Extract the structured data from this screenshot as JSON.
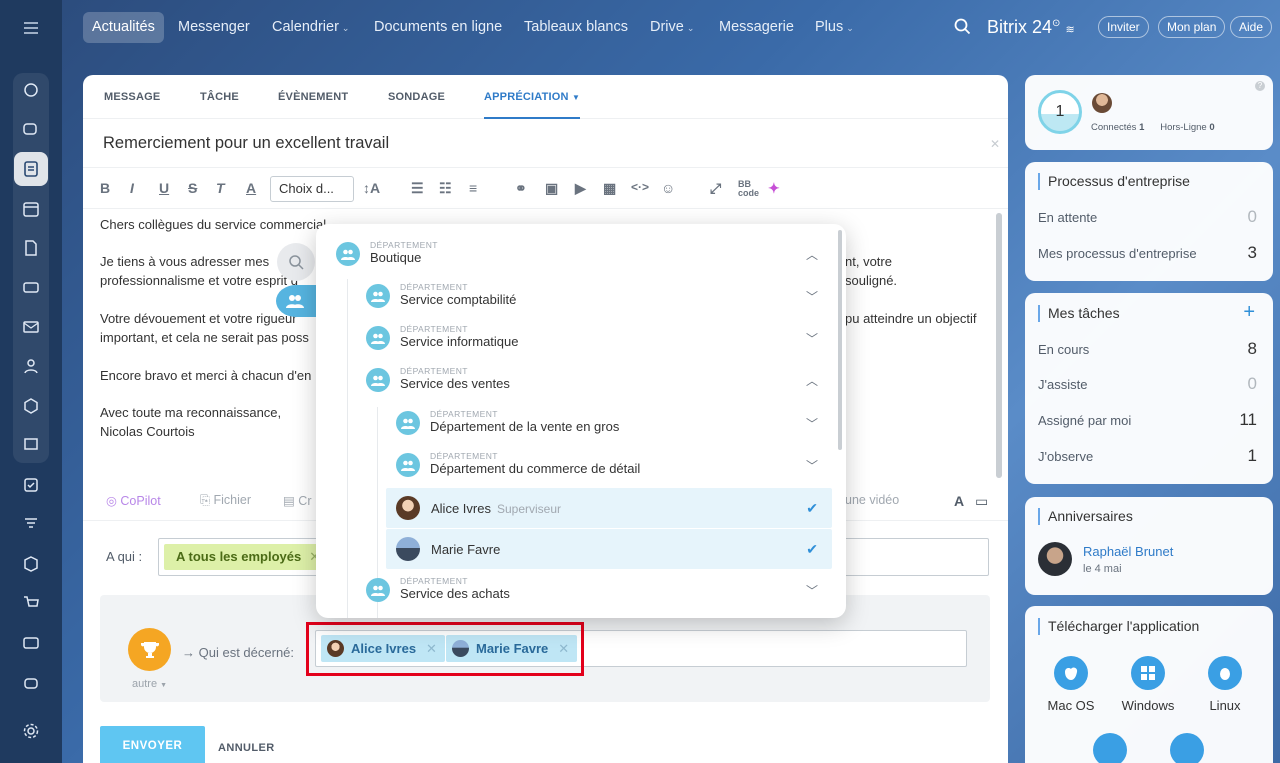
{
  "nav": {
    "items": [
      "Actualités",
      "Messenger",
      "Calendrier",
      "Documents en ligne",
      "Tableaux blancs",
      "Drive",
      "Messagerie",
      "Plus"
    ],
    "brand": "Bitrix 24",
    "invite": "Inviter",
    "plan": "Mon plan",
    "help": "Aide"
  },
  "composer": {
    "tabs": [
      "MESSAGE",
      "TÂCHE",
      "ÉVÈNEMENT",
      "SONDAGE",
      "APPRÉCIATION"
    ],
    "subject": "Remerciement pour un excellent travail",
    "font_select": "Choix d...",
    "body": [
      "Chers collègues du service commercial",
      "Je tiens à vous adresser mes",
      "nt, votre",
      "professionnalisme et votre esprit d",
      "souligné.",
      "Votre dévouement et votre rigueur",
      "pu atteindre un objectif",
      "important, et cela ne serait pas poss",
      "Encore bravo et merci à chacun d'en",
      "Avec toute ma reconnaissance,",
      "Nicolas Courtois"
    ],
    "attach": {
      "copilot": "CoPilot",
      "file": "Fichier",
      "create": "Cr",
      "video": "une vidéo"
    },
    "to_label": "A qui :",
    "to_chip": "A tous les employés",
    "award_label": "Qui est décerné:",
    "award_type": "autre",
    "recipients": [
      "Alice Ivres",
      "Marie Favre"
    ],
    "send": "ENVOYER",
    "cancel": "ANNULER"
  },
  "dropdown": {
    "kicker": "DÉPARTEMENT",
    "root": "Boutique",
    "departments": [
      "Service comptabilité",
      "Service informatique",
      "Service des ventes"
    ],
    "sub_departments": [
      "Département de la vente en gros",
      "Département du commerce de détail"
    ],
    "people": [
      {
        "name": "Alice Ivres",
        "role": "Superviseur"
      },
      {
        "name": "Marie Favre",
        "role": ""
      }
    ],
    "last": "Service des achats"
  },
  "online": {
    "count": "1",
    "connected_label": "Connectés",
    "connected": "1",
    "offline_label": "Hors-Ligne",
    "offline": "0"
  },
  "processes": {
    "title": "Processus d'entreprise",
    "rows": [
      {
        "label": "En attente",
        "value": "0"
      },
      {
        "label": "Mes processus d'entreprise",
        "value": "3"
      }
    ]
  },
  "tasks": {
    "title": "Mes tâches",
    "add": "+",
    "rows": [
      {
        "label": "En cours",
        "value": "8"
      },
      {
        "label": "J'assiste",
        "value": "0"
      },
      {
        "label": "Assigné par moi",
        "value": "11"
      },
      {
        "label": "J'observe",
        "value": "1"
      }
    ]
  },
  "birthdays": {
    "title": "Anniversaires",
    "name": "Raphaël Brunet",
    "date": "le 4 mai"
  },
  "download": {
    "title": "Télécharger l'application",
    "os": [
      "Mac OS",
      "Windows",
      "Linux"
    ]
  }
}
